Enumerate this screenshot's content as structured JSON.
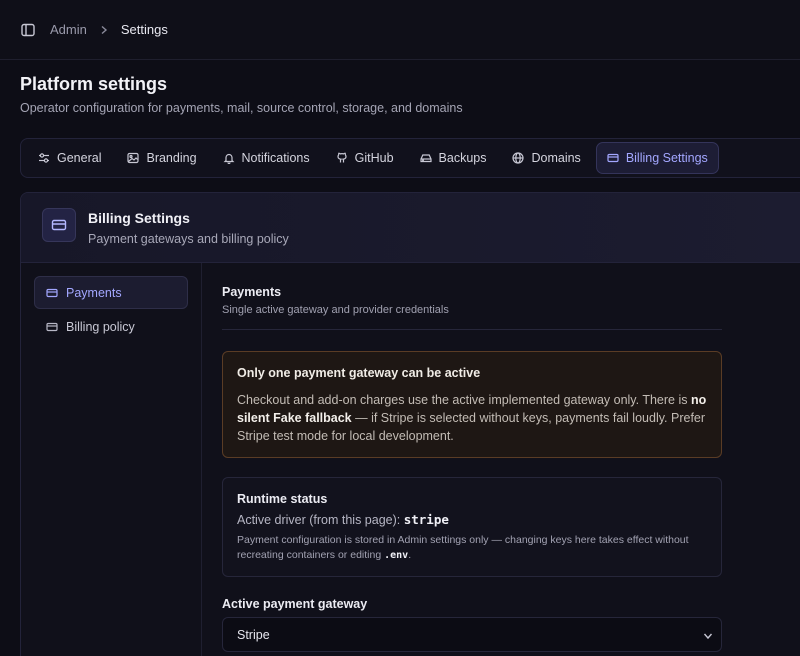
{
  "breadcrumb": {
    "items": [
      "Admin",
      "Settings"
    ]
  },
  "page": {
    "title": "Platform settings",
    "subtitle": "Operator configuration for payments, mail, source control, storage, and domains"
  },
  "tabs": [
    {
      "label": "General",
      "icon": "sliders-icon"
    },
    {
      "label": "Branding",
      "icon": "image-icon"
    },
    {
      "label": "Notifications",
      "icon": "bell-icon"
    },
    {
      "label": "GitHub",
      "icon": "github-icon"
    },
    {
      "label": "Backups",
      "icon": "hard-drive-icon"
    },
    {
      "label": "Domains",
      "icon": "globe-icon"
    },
    {
      "label": "Billing Settings",
      "icon": "credit-card-icon",
      "active": true
    }
  ],
  "card": {
    "title": "Billing Settings",
    "subtitle": "Payment gateways and billing policy"
  },
  "sidenav": [
    {
      "label": "Payments",
      "active": true
    },
    {
      "label": "Billing policy"
    }
  ],
  "payments": {
    "title": "Payments",
    "subtitle": "Single active gateway and provider credentials",
    "warning": {
      "title": "Only one payment gateway can be active",
      "text_1": "Checkout and add-on charges use the active implemented gateway only. There is ",
      "bold": "no silent Fake fallback",
      "text_2": " — if Stripe is selected without keys, payments fail loudly. Prefer Stripe test mode for local development."
    },
    "runtime": {
      "title": "Runtime status",
      "driver_label": "Active driver (from this page): ",
      "driver_value": "stripe",
      "note_1": "Payment configuration is stored in Admin settings only — changing keys here takes effect without recreating containers or editing ",
      "note_code": ".env",
      "note_2": "."
    },
    "gateway": {
      "label": "Active payment gateway",
      "selected": "Stripe"
    }
  },
  "colors": {
    "accent": "#a3a7ff",
    "warning_border": "#5a3c25",
    "background": "#0d0d16"
  }
}
